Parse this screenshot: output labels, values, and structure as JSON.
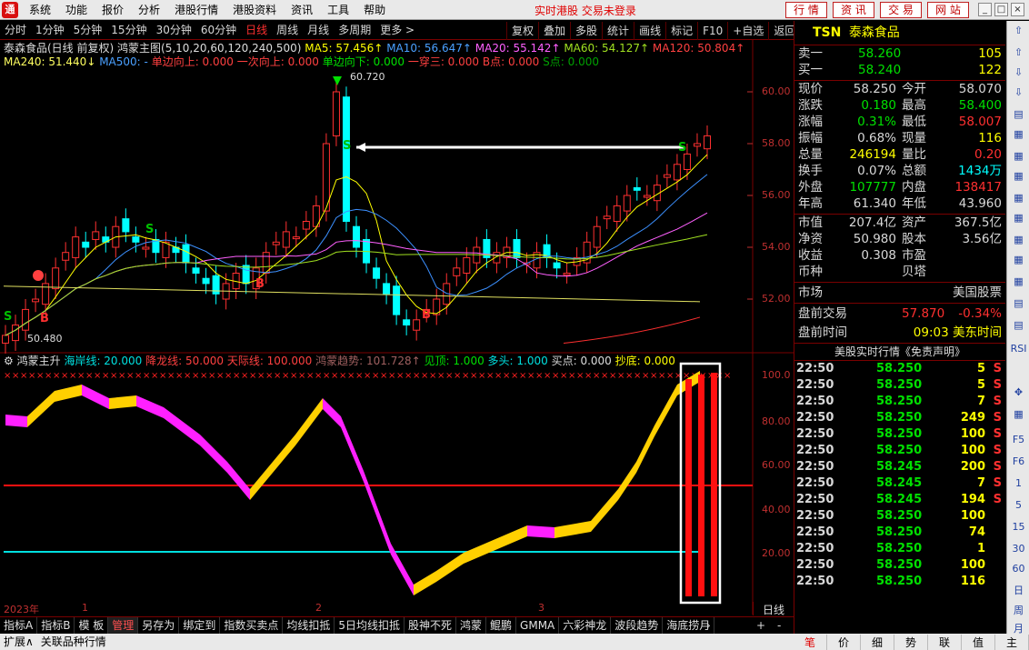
{
  "menu": {
    "items": [
      "系统",
      "功能",
      "报价",
      "分析",
      "港股行情",
      "港股资料",
      "资讯",
      "工具",
      "帮助"
    ],
    "status": "实时港股 交易未登录",
    "right_buttons": [
      "行 情",
      "资 讯",
      "交 易",
      "网 站"
    ]
  },
  "toolbar": {
    "periods": [
      "分时",
      "1分钟",
      "5分钟",
      "15分钟",
      "30分钟",
      "60分钟",
      "日线",
      "周线",
      "月线",
      "多周期",
      "更多 >"
    ],
    "active_period": "日线",
    "right_buttons": [
      "复权",
      "叠加",
      "多股",
      "统计",
      "画线",
      "标记",
      "F10",
      "+自选",
      "返回"
    ]
  },
  "main_header": {
    "title": "泰森食品(日线 前复权)",
    "indicator": "鸿蒙主图(5,10,20,60,120,240,500)",
    "ma5": "MA5: 57.456↑",
    "ma10": "MA10: 56.647↑",
    "ma20": "MA20: 55.142↑",
    "ma60": "MA60: 54.127↑",
    "ma120": "MA120: 50.804↑",
    "ma240": "MA240: 51.440↓",
    "ma500": "MA500: -",
    "dxs": "单边向上: 0.000",
    "ycxs": "一次向上: 0.000",
    "dxx": "单边向下: 0.000",
    "ycs": "一穿三: 0.000",
    "bd": "B点: 0.000",
    "sd": "S点: 0.000"
  },
  "price_axis": [
    "60.00",
    "58.00",
    "56.00",
    "54.00",
    "52.00"
  ],
  "annotations": {
    "high": "60.720",
    "low": "50.480"
  },
  "sub_header": {
    "name": "鸿蒙主升",
    "hax": "海岸线: 20.000",
    "jlx": "降龙线: 50.000",
    "tjx": "天际线: 100.000",
    "hmqs": "鸿蒙趋势: 101.728↑",
    "jd": "见顶: 1.000",
    "dt": "多头: 1.000",
    "md": "买点: 0.000",
    "cd": "抄底: 0.000"
  },
  "sub_axis": [
    "100.0",
    "80.00",
    "60.00",
    "40.00",
    "20.00"
  ],
  "date_axis": [
    "2023年",
    "1",
    "2",
    "3"
  ],
  "period_label": "日线",
  "bottom_tabs": [
    "指标A",
    "指标B",
    "模 板",
    "管理",
    "另存为",
    "绑定到",
    "指数买卖点",
    "均线扣抵",
    "5日均线扣抵",
    "股神不死",
    "鸿蒙",
    "鲲鹏",
    "GMMA",
    "六彩神龙",
    "波段趋势",
    "海底捞月"
  ],
  "active_bottom_tab": "管理",
  "status_bar": [
    "扩展∧",
    "关联品种行情"
  ],
  "quote": {
    "code": "TSN",
    "name": "泰森食品",
    "ask_label": "卖一",
    "ask_price": "58.260",
    "ask_vol": "105",
    "bid_label": "买一",
    "bid_price": "58.240",
    "bid_vol": "122",
    "rows": [
      {
        "l1": "现价",
        "v1": "58.250",
        "l2": "今开",
        "v2": "58.070",
        "c1": "w",
        "c2": "w"
      },
      {
        "l1": "涨跌",
        "v1": "0.180",
        "l2": "最高",
        "v2": "58.400",
        "c1": "g",
        "c2": "g"
      },
      {
        "l1": "涨幅",
        "v1": "0.31%",
        "l2": "最低",
        "v2": "58.007",
        "c1": "g",
        "c2": "r"
      },
      {
        "l1": "振幅",
        "v1": "0.68%",
        "l2": "现量",
        "v2": "116",
        "c1": "w",
        "c2": "y"
      },
      {
        "l1": "总量",
        "v1": "246194",
        "l2": "量比",
        "v2": "0.20",
        "c1": "y",
        "c2": "r"
      },
      {
        "l1": "换手",
        "v1": "0.07%",
        "l2": "总额",
        "v2": "1434万",
        "c1": "w",
        "c2": "c"
      },
      {
        "l1": "外盘",
        "v1": "107777",
        "l2": "内盘",
        "v2": "138417",
        "c1": "g",
        "c2": "r"
      },
      {
        "l1": "年高",
        "v1": "61.340",
        "l2": "年低",
        "v2": "43.960",
        "c1": "w",
        "c2": "w"
      }
    ],
    "fund": [
      {
        "l1": "市值",
        "v1": "207.4亿",
        "l2": "资产",
        "v2": "367.5亿"
      },
      {
        "l1": "净资",
        "v1": "50.980",
        "l2": "股本",
        "v2": "3.56亿"
      },
      {
        "l1": "收益",
        "v1": "0.308",
        "l2": "市盈",
        "v2": ""
      },
      {
        "l1": "币种",
        "v1": "",
        "l2": "贝塔",
        "v2": ""
      }
    ],
    "market_label": "市场",
    "market_value": "美国股票",
    "pre_label": "盘前交易",
    "pre_price": "57.870",
    "pre_pct": "-0.34%",
    "pre_time_label": "盘前时间",
    "pre_time": "09:03 美东时间",
    "ticks_title": "美股实时行情《免责声明》",
    "ticks": [
      {
        "t": "22:50",
        "p": "58.250",
        "v": "5",
        "s": "S"
      },
      {
        "t": "22:50",
        "p": "58.250",
        "v": "5",
        "s": "S"
      },
      {
        "t": "22:50",
        "p": "58.250",
        "v": "7",
        "s": "S"
      },
      {
        "t": "22:50",
        "p": "58.250",
        "v": "249",
        "s": "S"
      },
      {
        "t": "22:50",
        "p": "58.250",
        "v": "100",
        "s": "S"
      },
      {
        "t": "22:50",
        "p": "58.250",
        "v": "100",
        "s": "S"
      },
      {
        "t": "22:50",
        "p": "58.245",
        "v": "200",
        "s": "S"
      },
      {
        "t": "22:50",
        "p": "58.245",
        "v": "7",
        "s": "S"
      },
      {
        "t": "22:50",
        "p": "58.245",
        "v": "194",
        "s": "S"
      },
      {
        "t": "22:50",
        "p": "58.250",
        "v": "100",
        "s": ""
      },
      {
        "t": "22:50",
        "p": "58.250",
        "v": "74",
        "s": ""
      },
      {
        "t": "22:50",
        "p": "58.250",
        "v": "1",
        "s": ""
      },
      {
        "t": "22:50",
        "p": "58.250",
        "v": "100",
        "s": ""
      },
      {
        "t": "22:50",
        "p": "58.250",
        "v": "116",
        "s": ""
      }
    ]
  },
  "right_sidebar": [
    "RSI",
    "F5",
    "F6",
    "1",
    "5",
    "15",
    "30",
    "60",
    "日",
    "周",
    "月"
  ],
  "bottom_right_tabs": [
    "笔",
    "价",
    "细",
    "势",
    "联",
    "值",
    "主"
  ],
  "colors": {
    "up": "#ff2020",
    "down": "#00ffff",
    "accent": "#ffff00",
    "sell_green": "#00e000"
  }
}
